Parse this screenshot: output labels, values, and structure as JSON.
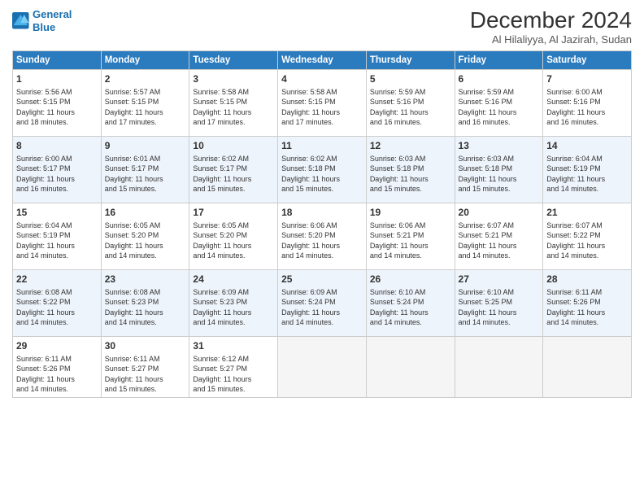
{
  "header": {
    "logo_line1": "General",
    "logo_line2": "Blue",
    "month": "December 2024",
    "location": "Al Hilaliyya, Al Jazirah, Sudan"
  },
  "weekdays": [
    "Sunday",
    "Monday",
    "Tuesday",
    "Wednesday",
    "Thursday",
    "Friday",
    "Saturday"
  ],
  "weeks": [
    [
      {
        "day": 1,
        "lines": [
          "Sunrise: 5:56 AM",
          "Sunset: 5:15 PM",
          "Daylight: 11 hours",
          "and 18 minutes."
        ]
      },
      {
        "day": 2,
        "lines": [
          "Sunrise: 5:57 AM",
          "Sunset: 5:15 PM",
          "Daylight: 11 hours",
          "and 17 minutes."
        ]
      },
      {
        "day": 3,
        "lines": [
          "Sunrise: 5:58 AM",
          "Sunset: 5:15 PM",
          "Daylight: 11 hours",
          "and 17 minutes."
        ]
      },
      {
        "day": 4,
        "lines": [
          "Sunrise: 5:58 AM",
          "Sunset: 5:15 PM",
          "Daylight: 11 hours",
          "and 17 minutes."
        ]
      },
      {
        "day": 5,
        "lines": [
          "Sunrise: 5:59 AM",
          "Sunset: 5:16 PM",
          "Daylight: 11 hours",
          "and 16 minutes."
        ]
      },
      {
        "day": 6,
        "lines": [
          "Sunrise: 5:59 AM",
          "Sunset: 5:16 PM",
          "Daylight: 11 hours",
          "and 16 minutes."
        ]
      },
      {
        "day": 7,
        "lines": [
          "Sunrise: 6:00 AM",
          "Sunset: 5:16 PM",
          "Daylight: 11 hours",
          "and 16 minutes."
        ]
      }
    ],
    [
      {
        "day": 8,
        "lines": [
          "Sunrise: 6:00 AM",
          "Sunset: 5:17 PM",
          "Daylight: 11 hours",
          "and 16 minutes."
        ]
      },
      {
        "day": 9,
        "lines": [
          "Sunrise: 6:01 AM",
          "Sunset: 5:17 PM",
          "Daylight: 11 hours",
          "and 15 minutes."
        ]
      },
      {
        "day": 10,
        "lines": [
          "Sunrise: 6:02 AM",
          "Sunset: 5:17 PM",
          "Daylight: 11 hours",
          "and 15 minutes."
        ]
      },
      {
        "day": 11,
        "lines": [
          "Sunrise: 6:02 AM",
          "Sunset: 5:18 PM",
          "Daylight: 11 hours",
          "and 15 minutes."
        ]
      },
      {
        "day": 12,
        "lines": [
          "Sunrise: 6:03 AM",
          "Sunset: 5:18 PM",
          "Daylight: 11 hours",
          "and 15 minutes."
        ]
      },
      {
        "day": 13,
        "lines": [
          "Sunrise: 6:03 AM",
          "Sunset: 5:18 PM",
          "Daylight: 11 hours",
          "and 15 minutes."
        ]
      },
      {
        "day": 14,
        "lines": [
          "Sunrise: 6:04 AM",
          "Sunset: 5:19 PM",
          "Daylight: 11 hours",
          "and 14 minutes."
        ]
      }
    ],
    [
      {
        "day": 15,
        "lines": [
          "Sunrise: 6:04 AM",
          "Sunset: 5:19 PM",
          "Daylight: 11 hours",
          "and 14 minutes."
        ]
      },
      {
        "day": 16,
        "lines": [
          "Sunrise: 6:05 AM",
          "Sunset: 5:20 PM",
          "Daylight: 11 hours",
          "and 14 minutes."
        ]
      },
      {
        "day": 17,
        "lines": [
          "Sunrise: 6:05 AM",
          "Sunset: 5:20 PM",
          "Daylight: 11 hours",
          "and 14 minutes."
        ]
      },
      {
        "day": 18,
        "lines": [
          "Sunrise: 6:06 AM",
          "Sunset: 5:20 PM",
          "Daylight: 11 hours",
          "and 14 minutes."
        ]
      },
      {
        "day": 19,
        "lines": [
          "Sunrise: 6:06 AM",
          "Sunset: 5:21 PM",
          "Daylight: 11 hours",
          "and 14 minutes."
        ]
      },
      {
        "day": 20,
        "lines": [
          "Sunrise: 6:07 AM",
          "Sunset: 5:21 PM",
          "Daylight: 11 hours",
          "and 14 minutes."
        ]
      },
      {
        "day": 21,
        "lines": [
          "Sunrise: 6:07 AM",
          "Sunset: 5:22 PM",
          "Daylight: 11 hours",
          "and 14 minutes."
        ]
      }
    ],
    [
      {
        "day": 22,
        "lines": [
          "Sunrise: 6:08 AM",
          "Sunset: 5:22 PM",
          "Daylight: 11 hours",
          "and 14 minutes."
        ]
      },
      {
        "day": 23,
        "lines": [
          "Sunrise: 6:08 AM",
          "Sunset: 5:23 PM",
          "Daylight: 11 hours",
          "and 14 minutes."
        ]
      },
      {
        "day": 24,
        "lines": [
          "Sunrise: 6:09 AM",
          "Sunset: 5:23 PM",
          "Daylight: 11 hours",
          "and 14 minutes."
        ]
      },
      {
        "day": 25,
        "lines": [
          "Sunrise: 6:09 AM",
          "Sunset: 5:24 PM",
          "Daylight: 11 hours",
          "and 14 minutes."
        ]
      },
      {
        "day": 26,
        "lines": [
          "Sunrise: 6:10 AM",
          "Sunset: 5:24 PM",
          "Daylight: 11 hours",
          "and 14 minutes."
        ]
      },
      {
        "day": 27,
        "lines": [
          "Sunrise: 6:10 AM",
          "Sunset: 5:25 PM",
          "Daylight: 11 hours",
          "and 14 minutes."
        ]
      },
      {
        "day": 28,
        "lines": [
          "Sunrise: 6:11 AM",
          "Sunset: 5:26 PM",
          "Daylight: 11 hours",
          "and 14 minutes."
        ]
      }
    ],
    [
      {
        "day": 29,
        "lines": [
          "Sunrise: 6:11 AM",
          "Sunset: 5:26 PM",
          "Daylight: 11 hours",
          "and 14 minutes."
        ]
      },
      {
        "day": 30,
        "lines": [
          "Sunrise: 6:11 AM",
          "Sunset: 5:27 PM",
          "Daylight: 11 hours",
          "and 15 minutes."
        ]
      },
      {
        "day": 31,
        "lines": [
          "Sunrise: 6:12 AM",
          "Sunset: 5:27 PM",
          "Daylight: 11 hours",
          "and 15 minutes."
        ]
      },
      null,
      null,
      null,
      null
    ]
  ]
}
